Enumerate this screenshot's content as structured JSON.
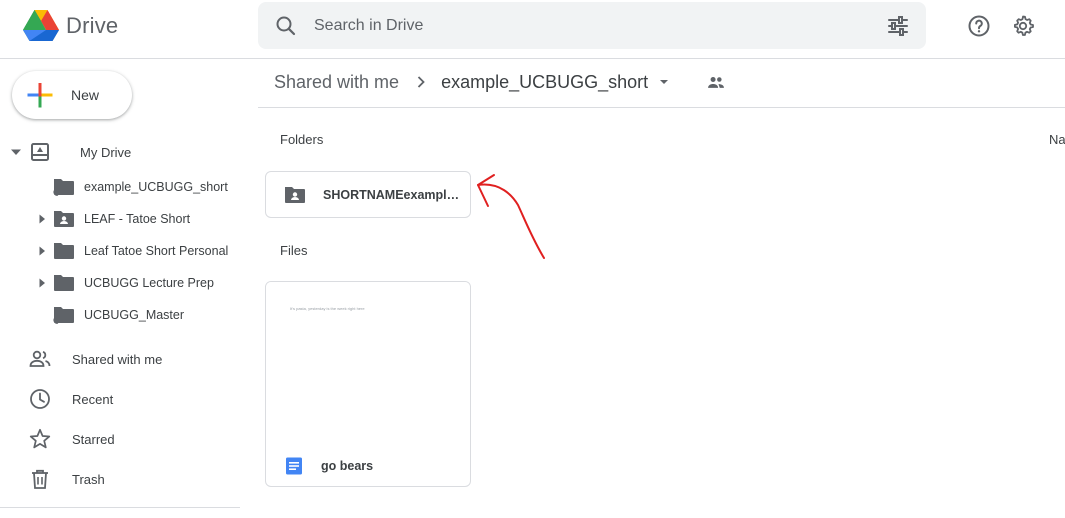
{
  "header": {
    "app_name": "Drive",
    "search_placeholder": "Search in Drive",
    "icons": [
      "drive-logo",
      "search-icon",
      "filter-icon",
      "help-icon",
      "settings-icon"
    ]
  },
  "sidebar": {
    "new_label": "New",
    "my_drive": "My Drive",
    "tree": [
      {
        "label": "example_UCBUGG_short",
        "icon": "shared-folder-icon",
        "expandable": false
      },
      {
        "label": "LEAF - Tatoe Short",
        "icon": "shared-drive-folder-icon",
        "expandable": true
      },
      {
        "label": "Leaf Tatoe Short Personal",
        "icon": "folder-icon",
        "expandable": true
      },
      {
        "label": "UCBUGG Lecture Prep",
        "icon": "folder-icon",
        "expandable": true
      },
      {
        "label": "UCBUGG_Master",
        "icon": "shared-folder-icon",
        "expandable": false
      }
    ],
    "nav": [
      {
        "label": "Shared with me",
        "icon": "people-icon"
      },
      {
        "label": "Recent",
        "icon": "clock-icon"
      },
      {
        "label": "Starred",
        "icon": "star-icon"
      },
      {
        "label": "Trash",
        "icon": "trash-icon"
      }
    ]
  },
  "main": {
    "breadcrumb": {
      "parent": "Shared with me",
      "current": "example_UCBUGG_short"
    },
    "sort_partial": "Na",
    "folders_label": "Folders",
    "files_label": "Files",
    "folders": [
      {
        "name": "SHORTNAMEexample_UCBUGG_short"
      }
    ],
    "files": [
      {
        "name": "go bears",
        "thumb_text": "It's pasta, yesterday is the week right here"
      }
    ]
  },
  "colors": {
    "annotation_red": "#e02020",
    "doc_blue": "#4285f4"
  }
}
